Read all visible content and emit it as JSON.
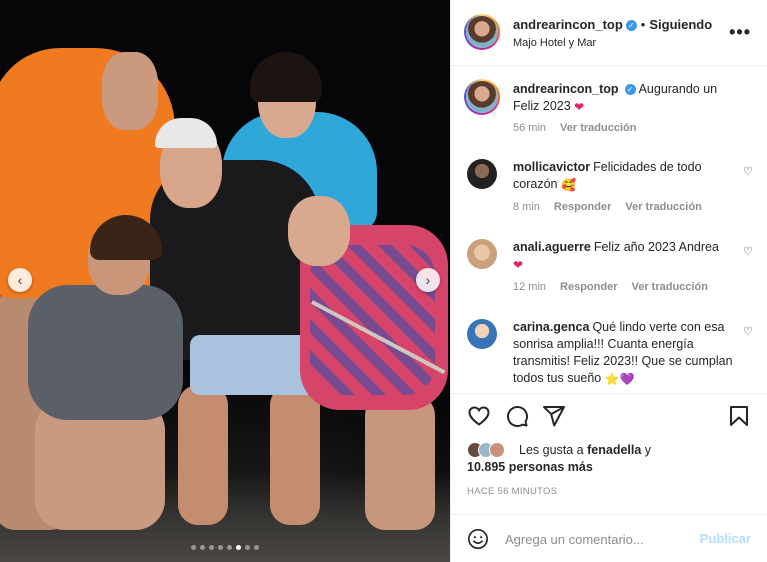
{
  "post": {
    "header": {
      "username": "andrearincon_top",
      "separator": "•",
      "follow_status": "Siguiendo",
      "location": "Majo Hotel y Mar",
      "more_icon": "more-horizontal-icon"
    },
    "photo": {
      "carousel_dots_total": 8,
      "carousel_active_index": 5
    }
  },
  "comments": [
    {
      "username": "andrearincon_top",
      "verified": true,
      "text": "Augurando un Feliz 2023",
      "emoji": "❤",
      "meta": {
        "time": "56 min",
        "translate": "Ver traducción"
      }
    },
    {
      "username": "mollicavictor",
      "text": "Felicidades de todo corazón",
      "emoji": "🥰",
      "meta": {
        "time": "8 min",
        "reply": "Responder",
        "translate": "Ver traducción"
      }
    },
    {
      "username": "anali.aguerre",
      "text": "Feliz año 2023 Andrea",
      "emoji": "❤",
      "meta": {
        "time": "12 min",
        "reply": "Responder",
        "translate": "Ver traducción"
      }
    },
    {
      "username": "carina.genca",
      "text": "Qué lindo verte con esa sonrisa amplia!!! Cuanta energía transmitis! Feliz 2023!! Que se cumplan todos tus sueño",
      "emoji": "⭐💜"
    }
  ],
  "likes": {
    "prefix": "Les gusta a",
    "user": "fenadella",
    "connector": "y",
    "others": "10.895 personas más"
  },
  "time_ago": "HACE 56 MINUTOS",
  "add_comment": {
    "placeholder": "Agrega un comentario...",
    "publish_label": "Publicar"
  },
  "colors": {
    "verified": "#3897f0",
    "publish_disabled": "#b2dffc",
    "meta_grey": "#8e8e8e"
  }
}
